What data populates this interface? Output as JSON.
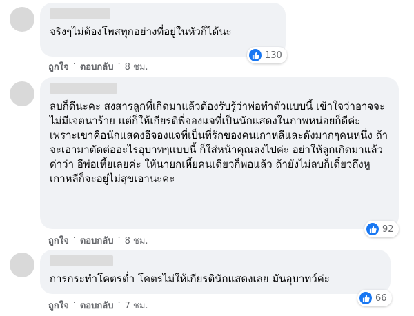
{
  "comments": [
    {
      "text": "จริงๆไม่ต้องโพสทุกอย่างที่อยู่ในหัวก็ได้นะ",
      "reaction_count": "130",
      "like_label": "ถูกใจ",
      "reply_label": "ตอบกลับ",
      "time": "8 ชม."
    },
    {
      "text": "ลบก็ดีนะคะ สงสารลูกที่เกิดมาแล้วต้องรับรู้ว่าพ่อทำตัวแบบนี้ เข้าใจว่าอาจจะไม่มีเจตนาร้าย แต่ก็ให้เกียรติพี่จองแจที่เป็นนักแสดงในภาพหน่อยก็ดีค่ะ เพราะเขาคือนักแสดงอีจองแจที่เป็นที่รักของคนเกาหลีและดังมากๆคนหนึ่ง ถ้าจะเอามาตัดต่ออะไรอุบาทๆแบบนี้ ก็ใส่หน้าคุณลงไปค่ะ อย่าให้ลูกเกิดมาแล้วด่าว่า อีพ่อเหี้ยเลยค่ะ ให้นายกเหี้ยคนเดียวก็พอแล้ว ถ้ายังไม่ลบก็เดี๋ยวถึงหูเกาหลีก็จะอยู่ไม่สุขเอานะคะ",
      "reaction_count": "92",
      "like_label": "ถูกใจ",
      "reply_label": "ตอบกลับ",
      "time": "8 ชม."
    },
    {
      "text": "การกระทำโคตรต่ำ โคตรไม่ให้เกียรตินักแสดงเลย มันอุบาทว์ค่ะ",
      "reaction_count": "66",
      "like_label": "ถูกใจ",
      "reply_label": "ตอบกลับ",
      "time": "7 ชม."
    }
  ],
  "colors": {
    "bubble": "#f0f2f5",
    "like_blue": "#1877f2",
    "meta_text": "#65676b"
  },
  "icons": {
    "reaction": "like-thumb-icon"
  }
}
